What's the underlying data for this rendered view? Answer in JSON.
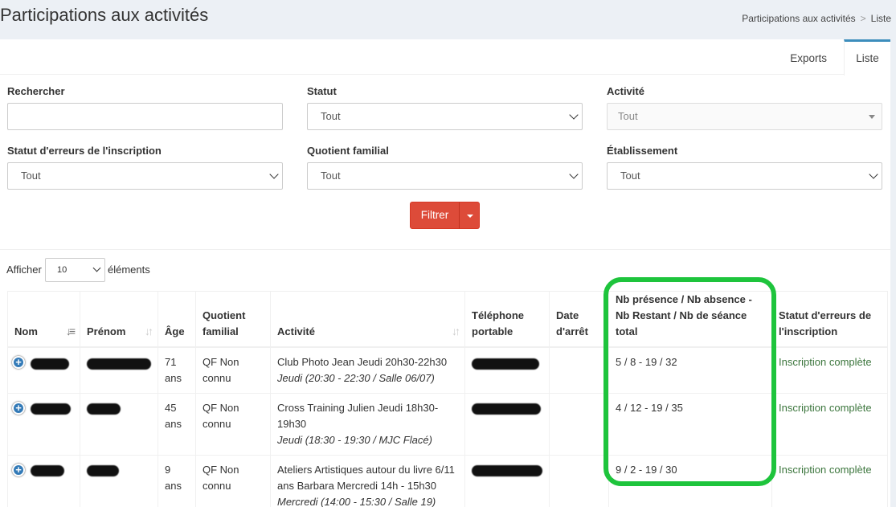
{
  "page": {
    "title": "Participations aux activités",
    "breadcrumb": [
      "Participations aux activités",
      "Liste"
    ]
  },
  "tabs": [
    {
      "label": "Exports",
      "active": false
    },
    {
      "label": "Liste",
      "active": true
    }
  ],
  "filters": {
    "rechercher": {
      "label": "Rechercher",
      "value": ""
    },
    "statut": {
      "label": "Statut",
      "value": "Tout"
    },
    "activite": {
      "label": "Activité",
      "value": "Tout"
    },
    "statut_erreurs": {
      "label": "Statut d'erreurs de l'inscription",
      "value": "Tout"
    },
    "quotient": {
      "label": "Quotient familial",
      "value": "Tout"
    },
    "etablissement": {
      "label": "Établissement",
      "value": "Tout"
    }
  },
  "filter_button": {
    "label": "Filtrer"
  },
  "length_menu": {
    "prefix": "Afficher",
    "value": "10",
    "suffix": "éléments"
  },
  "table": {
    "headers": {
      "nom": "Nom",
      "prenom": "Prénom",
      "age": "Âge",
      "quotient": "Quotient familial",
      "activite": "Activité",
      "telephone": "Téléphone portable",
      "date_arret": "Date d'arrêt",
      "nb": "Nb présence / Nb absence - Nb Restant / Nb de séance total",
      "statut": "Statut d'erreurs de l'inscription"
    },
    "rows": [
      {
        "age": "71 ans",
        "quotient": "QF Non connu",
        "activite": "Club Photo Jean Jeudi 20h30-22h30",
        "activite_detail": "Jeudi (20:30 - 22:30 / Salle 06/07)",
        "date_arret": "",
        "nb": "5 / 8 - 19 / 32",
        "statut": "Inscription complète"
      },
      {
        "age": "45 ans",
        "quotient": "QF Non connu",
        "activite": "Cross Training Julien Jeudi 18h30-19h30",
        "activite_detail": "Jeudi (18:30 - 19:30 / MJC Flacé)",
        "date_arret": "",
        "nb": "4 / 12 - 19 / 35",
        "statut": "Inscription complète"
      },
      {
        "age": "9 ans",
        "quotient": "QF Non connu",
        "activite": "Ateliers Artistiques autour du livre 6/11 ans Barbara Mercredi 14h - 15h30",
        "activite_detail": "Mercredi (14:00 - 15:30 / Salle 19)",
        "date_arret": "",
        "nb": "9 / 2 - 19 / 30",
        "statut": "Inscription complète"
      }
    ]
  },
  "colors": {
    "accent": "#3c8dbc",
    "filter_button": "#dd4b39",
    "status_ok": "#3c763d",
    "highlight": "#1ec43c"
  }
}
